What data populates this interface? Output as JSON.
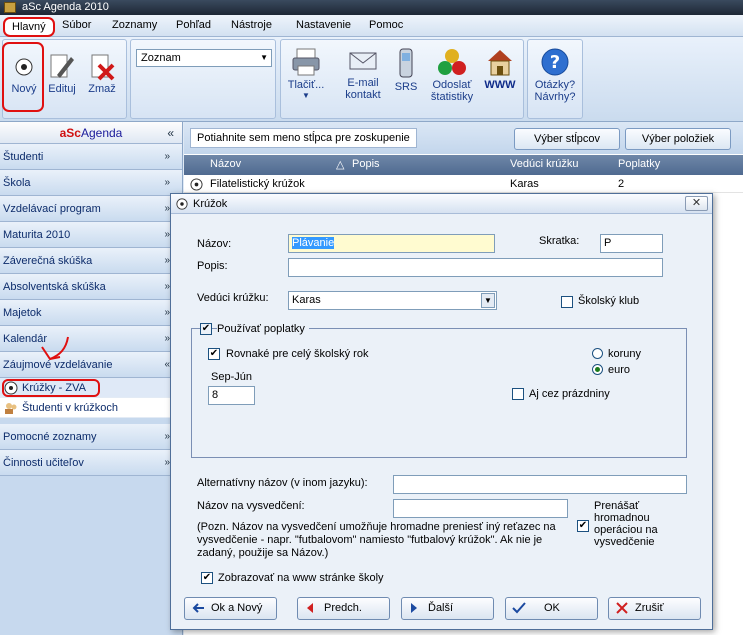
{
  "window": {
    "title": "aSc Agenda 2010"
  },
  "menu": [
    "Hlavný",
    "Súbor",
    "Zoznamy",
    "Pohľad",
    "Nástroje",
    "Nastavenie",
    "Pomoc"
  ],
  "ribbon": {
    "new": "Nový",
    "edit": "Edituj",
    "delete": "Zmaž",
    "combo_value": "Zoznam",
    "print": "Tlačiť...",
    "email_l1": "E-mail",
    "email_l2": "kontakt",
    "srs": "SRS",
    "stats_l1": "Odoslať",
    "stats_l2": "štatistiky",
    "www": "WWW",
    "help_l1": "Otázky?",
    "help_l2": "Návrhy?"
  },
  "sidebar": {
    "brand_a": "aSc",
    "brand_b": "Agenda",
    "items": [
      "Študenti",
      "Škola",
      "Vzdelávací program",
      "Maturita 2010",
      "Záverečná skúška",
      "Absolventská skúška",
      "Majetok",
      "Kalendár",
      "Záujmové vzdelávanie"
    ],
    "sub": [
      "Krúžky - ZVA",
      "Študenti v krúžkoch"
    ],
    "items_after": [
      "Pomocné zoznamy",
      "Činnosti učiteľov"
    ]
  },
  "grid": {
    "group_hint": "Potiahnite sem meno stĺpca pre zoskupenie",
    "btn_columns": "Výber stĺpcov",
    "btn_items": "Výber položiek",
    "columns": [
      "Názov",
      "Popis",
      "Vedúci krúžku",
      "Poplatky"
    ],
    "rows": [
      {
        "name": "Filatelistický krúžok",
        "desc": "",
        "leader": "Karas",
        "fee": "2"
      }
    ]
  },
  "dialog": {
    "title": "Krúžok",
    "name_label": "Názov:",
    "name_value": "Plávanie",
    "abbr_label": "Skratka:",
    "abbr_value": "P",
    "desc_label": "Popis:",
    "leader_label": "Vedúci krúžku:",
    "leader_value": "Karas",
    "school_club": "Školský klub",
    "use_fees": "Používať poplatky",
    "same_year": "Rovnaké pre celý školský rok",
    "cur_koruny": "koruny",
    "cur_euro": "euro",
    "period_label": "Sep-Jún",
    "period_value": "8",
    "holidays": "Aj cez prázdniny",
    "alt_name_label": "Alternatívny názov (v inom jazyku):",
    "cert_name_label": "Názov na vysvedčení:",
    "transfer": [
      "Prenášať",
      "hromadnou",
      "operáciou na",
      "vysvedčenie"
    ],
    "note": [
      "(Pozn. Názov na vysvedčení umožňuje hromadne preniesť iný reťazec na",
      "vysvedčenie - napr. \"futbalovom\" namiesto \"futbalový krúžok\". Ak nie je",
      "zadaný, použije sa Názov.)"
    ],
    "show_web": "Zobrazovať na www stránke školy",
    "btn_ok_new": "Ok a Nový",
    "btn_prev": "Predch.",
    "btn_next": "Ďalší",
    "btn_ok": "OK",
    "btn_cancel": "Zrušiť"
  },
  "colors": {
    "highlight": "#e01010",
    "accent": "#1b3d8a"
  }
}
